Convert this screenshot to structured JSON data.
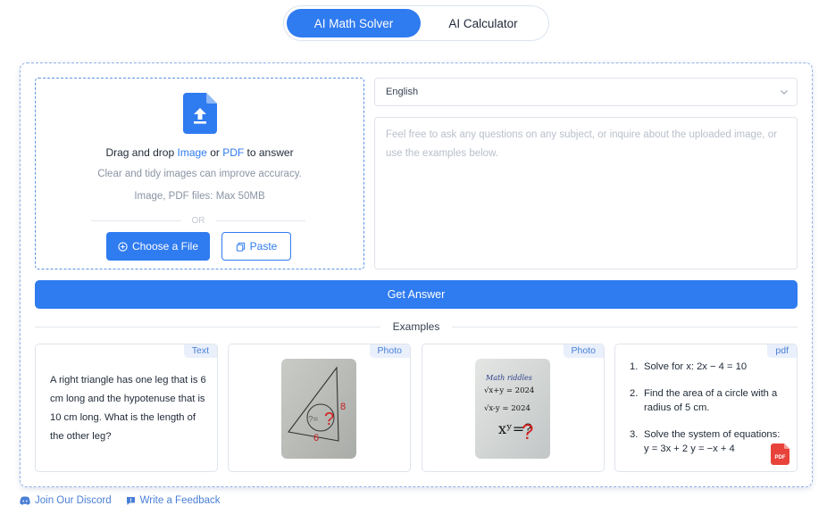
{
  "tabs": [
    {
      "label": "AI Math Solver",
      "active": true
    },
    {
      "label": "AI Calculator",
      "active": false
    }
  ],
  "upload": {
    "icon": "file-upload-icon",
    "drag_prefix": "Drag and drop ",
    "drag_image": "Image",
    "drag_or": " or ",
    "drag_pdf": "PDF",
    "drag_suffix": " to answer",
    "hint_accuracy": "Clear and tidy images can improve accuracy.",
    "hint_limits": "Image, PDF files: Max 50MB",
    "or_label": "OR",
    "choose_label": "Choose a File",
    "paste_label": "Paste"
  },
  "language": {
    "value": "English"
  },
  "question": {
    "placeholder": "Feel free to ask any questions on any subject, or inquire about the uploaded image, or use the examples below."
  },
  "get_answer_label": "Get Answer",
  "examples_label": "Examples",
  "examples": [
    {
      "tag": "Text",
      "content": "A right triangle has one leg that is 6 cm long and the hypotenuse that is 10 cm long. What is the length of the other leg?"
    },
    {
      "tag": "Photo",
      "photo_text": [
        "8",
        "6",
        "?"
      ]
    },
    {
      "tag": "Photo",
      "photo_text": [
        "Math riddles",
        "√x+y = 2024",
        "√x-y = 2024",
        "xʸ=?"
      ]
    },
    {
      "tag": "pdf",
      "items": [
        {
          "num": "1.",
          "text": "Solve for x: 2x − 4 = 10"
        },
        {
          "num": "2.",
          "text": "Find the area of a circle with a radius of 5 cm."
        },
        {
          "num": "3.",
          "text": "Solve the system of equations: y = 3x + 2 y = −x + 4"
        }
      ],
      "badge": "PDF"
    }
  ],
  "footer": {
    "discord": "Join Our Discord",
    "feedback": "Write a Feedback"
  },
  "colors": {
    "accent": "#2f7bf0",
    "tag_bg": "#e9f0fc",
    "pdf_red": "#e8433b"
  }
}
